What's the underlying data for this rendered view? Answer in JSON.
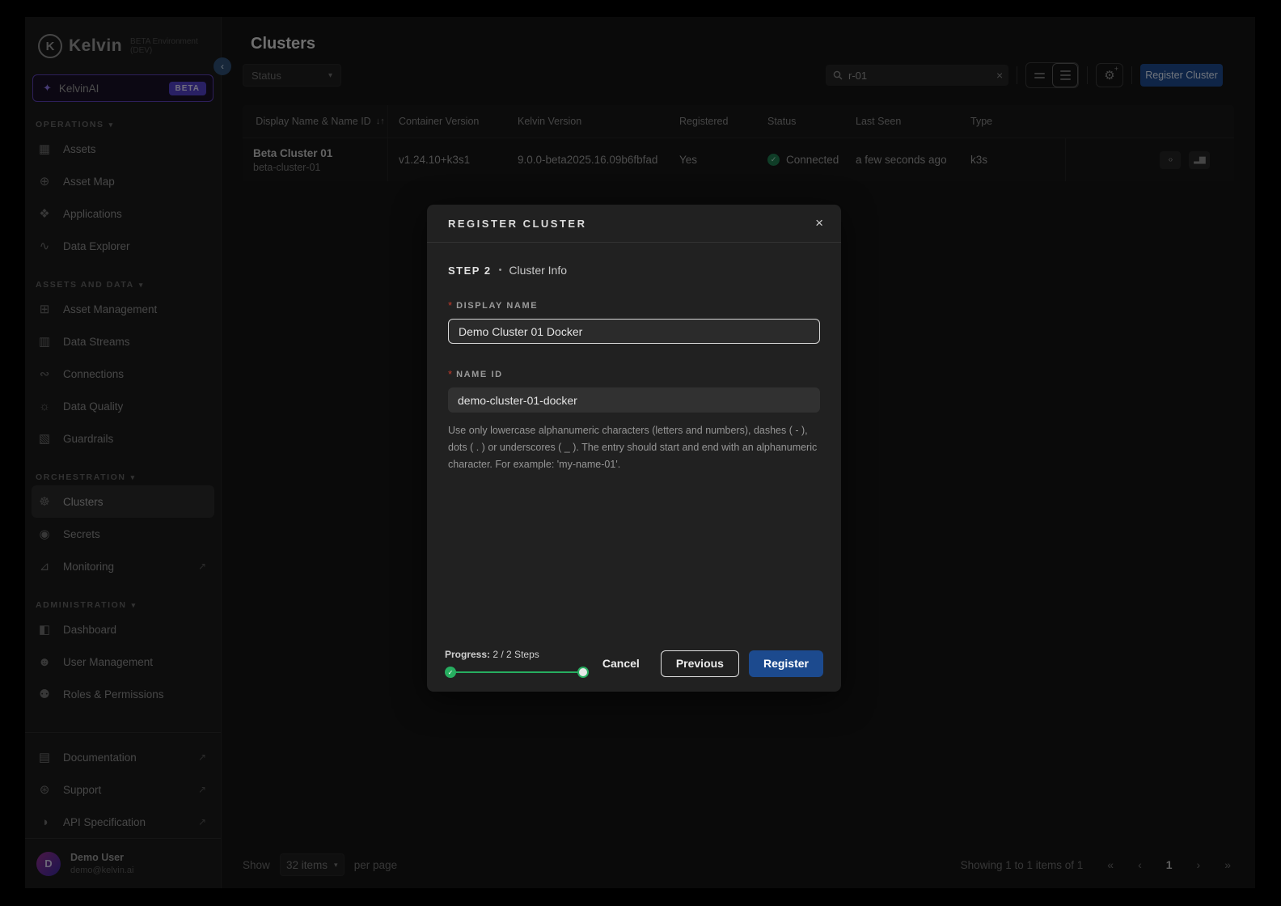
{
  "app": {
    "logo_letter": "K",
    "logo_text": "Kelvin",
    "env_label": "BETA Environment (DEV)",
    "page_title": "Clusters"
  },
  "colors": {
    "brand_blue": "#1c4a8e",
    "success_green": "#27ae60",
    "beta_purple": "#5240c9",
    "required_red": "#c0392b"
  },
  "icons": {
    "sparkle": "✦",
    "assets": "▦",
    "asset_map": "⊕",
    "applications": "❖",
    "data_explorer": "∿",
    "asset_management": "⊞",
    "data_streams": "▥",
    "connections": "∾",
    "data_quality": "☼",
    "guardrails": "▧",
    "clusters": "☸",
    "secrets": "◉",
    "monitoring": "⊿",
    "dashboard": "◧",
    "user_management": "☻",
    "roles_permissions": "⚉",
    "documentation": "▤",
    "support": "⊛",
    "api_specification": "◑",
    "external": "↗",
    "chevron_down": "▾",
    "chevron_left": "‹",
    "close": "×",
    "check": "✓",
    "sort": "↓↑",
    "clear": "×",
    "gear": "⚙",
    "gear_plus": "+",
    "code": "‹›",
    "metrics": "▂▆",
    "first": "«",
    "prev": "‹",
    "next": "›",
    "last": "»",
    "bullet": "•",
    "asterisk": "*"
  },
  "sidebar": {
    "ai_item": {
      "label": "KelvinAI",
      "badge": "BETA"
    },
    "sections": [
      {
        "label": "OPERATIONS",
        "items": [
          {
            "label": "Assets"
          },
          {
            "label": "Asset Map"
          },
          {
            "label": "Applications"
          },
          {
            "label": "Data Explorer"
          }
        ]
      },
      {
        "label": "ASSETS AND DATA",
        "items": [
          {
            "label": "Asset Management"
          },
          {
            "label": "Data Streams"
          },
          {
            "label": "Connections"
          },
          {
            "label": "Data Quality"
          },
          {
            "label": "Guardrails"
          }
        ]
      },
      {
        "label": "ORCHESTRATION",
        "items": [
          {
            "label": "Clusters"
          },
          {
            "label": "Secrets"
          },
          {
            "label": "Monitoring"
          }
        ]
      },
      {
        "label": "ADMINISTRATION",
        "items": [
          {
            "label": "Dashboard"
          },
          {
            "label": "User Management"
          },
          {
            "label": "Roles & Permissions"
          }
        ]
      }
    ],
    "footer_items": [
      {
        "label": "Documentation"
      },
      {
        "label": "Support"
      },
      {
        "label": "API Specification"
      }
    ],
    "user": {
      "initial": "D",
      "name": "Demo User",
      "email": "demo@kelvin.ai"
    }
  },
  "toolbar": {
    "status_filter": "Status",
    "search_value": "r-01",
    "register_button": "Register Cluster"
  },
  "table": {
    "columns": {
      "name": "Display Name & Name ID",
      "container_version": "Container Version",
      "kelvin_version": "Kelvin Version",
      "registered": "Registered",
      "status": "Status",
      "last_seen": "Last Seen",
      "type": "Type"
    },
    "rows": [
      {
        "display_name": "Beta Cluster 01",
        "name_id": "beta-cluster-01",
        "container_version": "v1.24.10+k3s1",
        "kelvin_version": "9.0.0-beta2025.16.09b6fbfad",
        "registered": "Yes",
        "status": "Connected",
        "last_seen": "a few seconds ago",
        "type": "k3s"
      }
    ]
  },
  "modal": {
    "title": "REGISTER CLUSTER",
    "step_label": "STEP 2",
    "step_name": "Cluster Info",
    "fields": {
      "display_name": {
        "label": "DISPLAY NAME",
        "value": "Demo Cluster 01 Docker"
      },
      "name_id": {
        "label": "NAME ID",
        "value": "demo-cluster-01-docker",
        "help": "Use only lowercase alphanumeric characters (letters and numbers), dashes ( - ), dots ( . ) or underscores ( _ ). The entry should start and end with an alphanumeric character. For example: 'my-name-01'."
      }
    },
    "progress": {
      "label": "Progress:",
      "text": "2 / 2 Steps"
    },
    "buttons": {
      "cancel": "Cancel",
      "previous": "Previous",
      "register": "Register"
    }
  },
  "pagination": {
    "show_label": "Show",
    "page_size": "32 items",
    "per_page_label": "per page",
    "summary": "Showing 1 to 1 items of 1",
    "current_page": "1"
  }
}
